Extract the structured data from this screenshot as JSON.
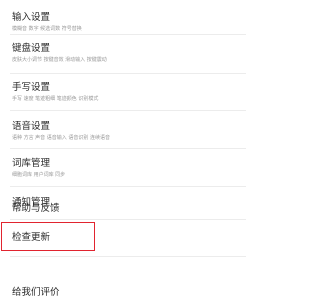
{
  "settings": {
    "items": [
      {
        "title": "输入设置",
        "subtitle": "模糊音 数字 候选词数 符号替换"
      },
      {
        "title": "键盘设置",
        "subtitle": "皮肤大小调节 按键音效 滑动输入 按键震动"
      },
      {
        "title": "手写设置",
        "subtitle": "手写 速度 笔迹粗细 笔迹颜色 识别模式"
      },
      {
        "title": "语音设置",
        "subtitle": "语种 方言 声音 语音输入 语音识别 连续语音"
      },
      {
        "title": "词库管理",
        "subtitle": "细胞词库 用户词库 同步"
      },
      {
        "title": "通知管理"
      },
      {
        "title": "帮助与反馈"
      },
      {
        "title": "检查更新"
      },
      {
        "title": "给我们评价"
      }
    ]
  },
  "highlight_color": "#e1242f"
}
